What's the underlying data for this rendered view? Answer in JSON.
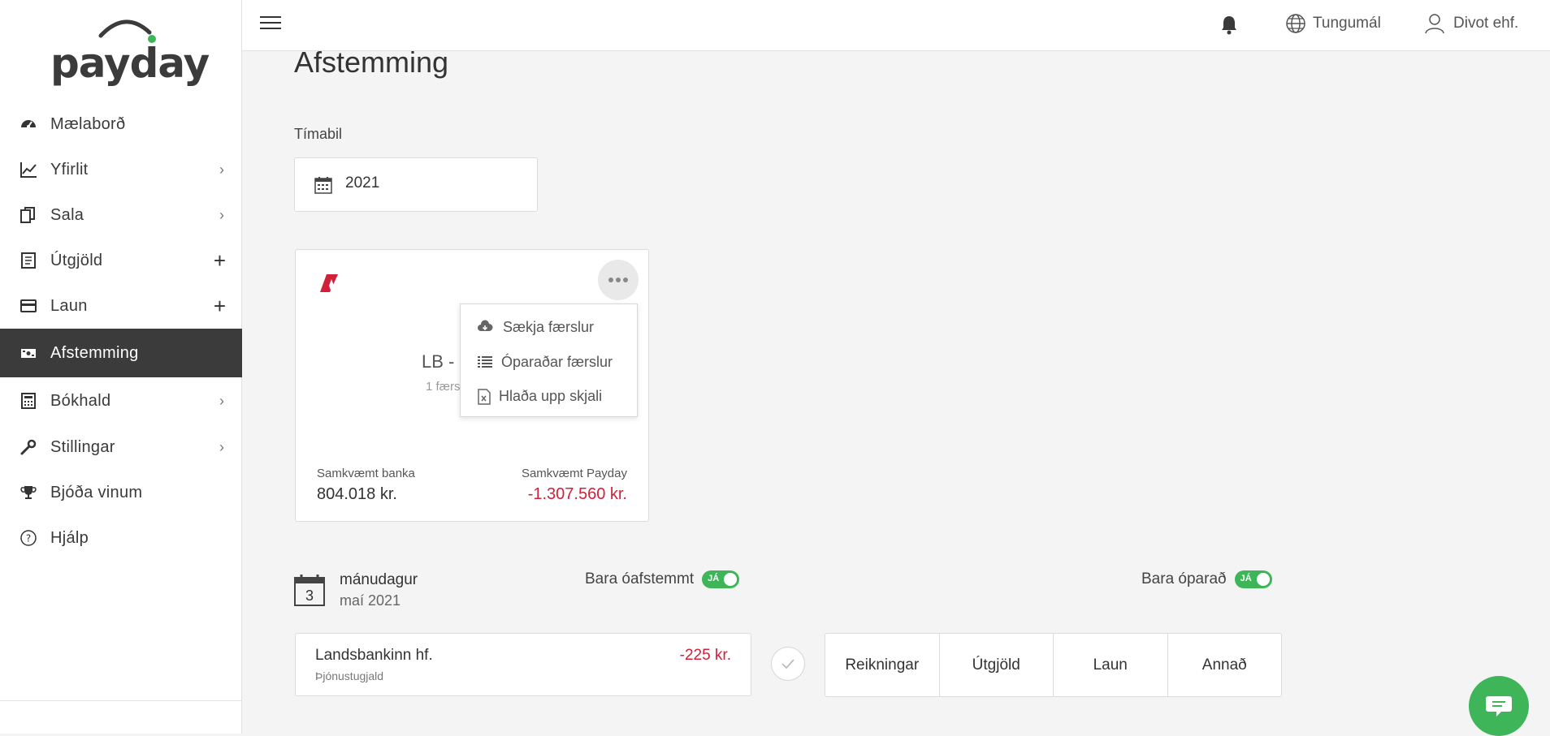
{
  "brand": {
    "name": "payday",
    "dot_color": "#3fb55a"
  },
  "sidebar": {
    "items": [
      {
        "label": "Mælaborð",
        "icon": "gauge-icon",
        "suffix": ""
      },
      {
        "label": "Yfirlit",
        "icon": "chart-line-icon",
        "suffix": "chevron"
      },
      {
        "label": "Sala",
        "icon": "documents-icon",
        "suffix": "chevron"
      },
      {
        "label": "Útgjöld",
        "icon": "receipt-icon",
        "suffix": "plus"
      },
      {
        "label": "Laun",
        "icon": "credit-card-icon",
        "suffix": "plus"
      },
      {
        "label": "Afstemming",
        "icon": "money-icon",
        "suffix": "",
        "active": true
      },
      {
        "label": "Bókhald",
        "icon": "calculator-icon",
        "suffix": "chevron"
      },
      {
        "label": "Stillingar",
        "icon": "wrench-icon",
        "suffix": "chevron"
      },
      {
        "label": "Bjóða vinum",
        "icon": "trophy-icon",
        "suffix": ""
      },
      {
        "label": "Hjálp",
        "icon": "help-circle-icon",
        "suffix": ""
      }
    ]
  },
  "topbar": {
    "language_label": "Tungumál",
    "user_label": "Divot ehf."
  },
  "main": {
    "title": "Afstemming",
    "period_label": "Tímabil",
    "period_value": "2021",
    "bank_card": {
      "name": "LB - ",
      "sub": "1 færs",
      "bank_label": "Samkvæmt banka",
      "bank_value": "804.018 kr.",
      "payday_label": "Samkvæmt Payday",
      "payday_value": "-1.307.560 kr."
    },
    "dropdown": {
      "items": [
        {
          "label": "Sækja færslur",
          "icon": "cloud-download-icon"
        },
        {
          "label": "Óparaðar færslur",
          "icon": "list-icon"
        },
        {
          "label": "Hlaða upp skjali",
          "icon": "excel-file-icon"
        }
      ]
    },
    "day": {
      "day_number": "3",
      "weekday": "mánudagur",
      "month_year": "maí 2021"
    },
    "toggles": {
      "unreconciled_label": "Bara óafstemmt",
      "unreconciled_state": "JÁ",
      "unmatched_label": "Bara óparað",
      "unmatched_state": "JÁ"
    },
    "transaction": {
      "name": "Landsbankinn hf.",
      "description": "Þjónustugjald",
      "amount": "-225 kr."
    },
    "categories": [
      "Reikningar",
      "Útgjöld",
      "Laun",
      "Annað"
    ]
  },
  "colors": {
    "accent": "#3fb55a",
    "negative": "#d0203a",
    "active_nav": "#3b3b3b"
  }
}
